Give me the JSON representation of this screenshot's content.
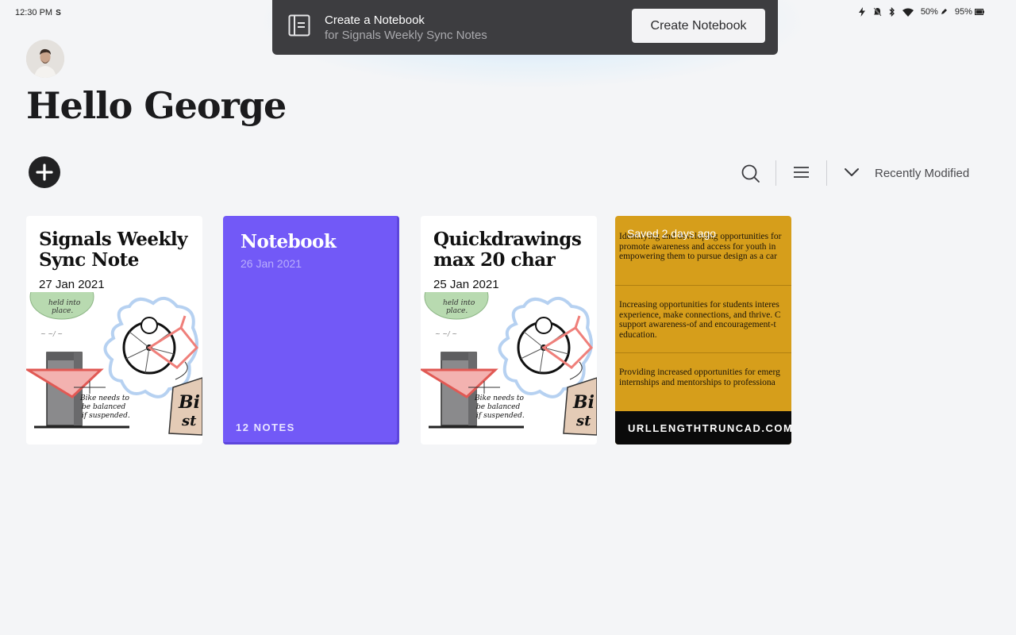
{
  "status_bar": {
    "time": "12:30 PM",
    "time_badge": "S",
    "battery_stylus": "50%",
    "battery_device": "95%"
  },
  "toast": {
    "title": "Create a Notebook",
    "subtitle": "for Signals Weekly Sync Notes",
    "button_label": "Create Notebook"
  },
  "header": {
    "greeting": "Hello George"
  },
  "toolbar": {
    "sort_label": "Recently Modified",
    "icons": [
      "add-icon",
      "search-icon",
      "list-icon",
      "chevron-down-icon"
    ]
  },
  "cards": [
    {
      "title": "Signals Weekly Sync Note",
      "date": "27 Jan 2021"
    },
    {
      "title": "Notebook",
      "date": "26 Jan 2021",
      "count": "12 NOTES",
      "color": "#7259f7"
    },
    {
      "title": "Quickdrawings max 20 char",
      "date": "25 Jan 2021"
    },
    {
      "saved": "Saved 2 days ago",
      "url": "URLLENGTHTRUNCAD.COM",
      "color": "#d69e1b",
      "paragraphs": [
        [
          "Identifying and developing opportunities for",
          "promote awareness and access for youth in",
          "empowering them to pursue design as a car"
        ],
        [
          "Increasing opportunities for students interes",
          "experience, make connections, and thrive. C",
          "support awareness-of and encouragement-t",
          "education."
        ],
        [
          "Providing increased opportunities for emerg",
          "internships and mentorships to professiona"
        ]
      ]
    }
  ],
  "sketch_text": {
    "top_label_1": "held into",
    "top_label_2": "place.",
    "caption_1": "Bike needs to",
    "caption_2": "be balanced",
    "caption_3": "if suspended.",
    "box_label_1": "Bi",
    "box_label_2": "st"
  }
}
